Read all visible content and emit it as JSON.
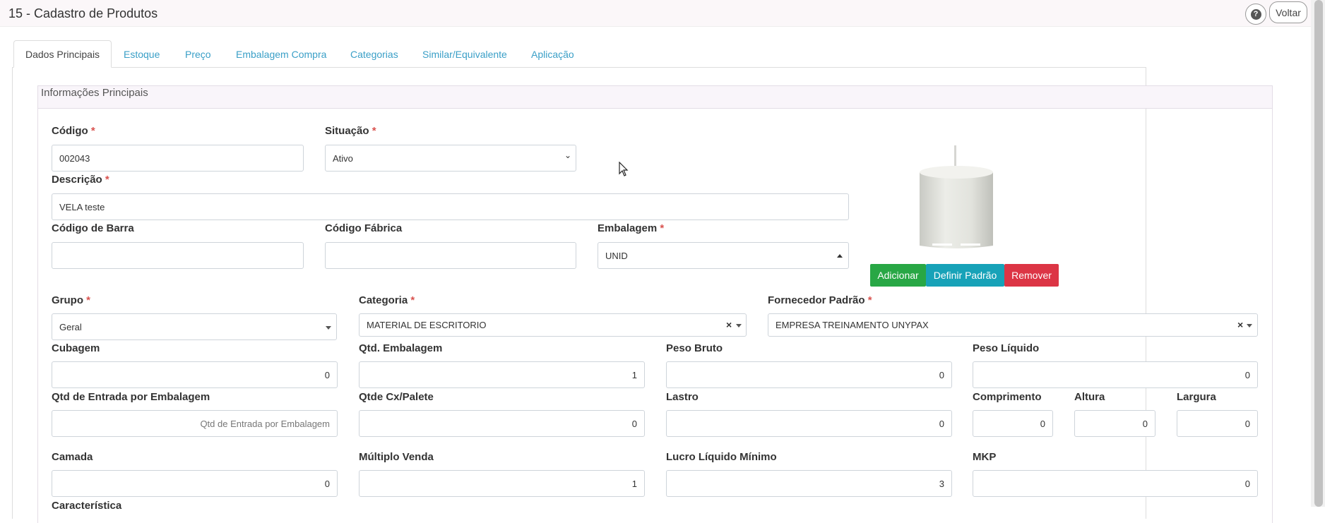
{
  "header": {
    "title": "15 - Cadastro de Produtos",
    "help_icon": "question-circle-icon",
    "help_glyph": "?",
    "back_label": "Voltar"
  },
  "tabs": [
    {
      "label": "Dados Principais",
      "active": true
    },
    {
      "label": "Estoque"
    },
    {
      "label": "Preço"
    },
    {
      "label": "Embalagem Compra"
    },
    {
      "label": "Categorias"
    },
    {
      "label": "Similar/Equivalente"
    },
    {
      "label": "Aplicação"
    }
  ],
  "section": {
    "title": "Informações Principais"
  },
  "required_mark": "*",
  "fields": {
    "codigo": {
      "label": "Código",
      "value": "002043"
    },
    "situacao": {
      "label": "Situação",
      "value": "Ativo"
    },
    "descricao": {
      "label": "Descrição",
      "value": "VELA teste"
    },
    "codigo_barra": {
      "label": "Código de Barra",
      "value": ""
    },
    "codigo_fabrica": {
      "label": "Código Fábrica",
      "value": ""
    },
    "embalagem": {
      "label": "Embalagem",
      "value": "UNID"
    },
    "grupo": {
      "label": "Grupo",
      "value": "Geral"
    },
    "categoria": {
      "label": "Categoria",
      "value": "MATERIAL DE ESCRITORIO"
    },
    "fornecedor": {
      "label": "Fornecedor Padrão",
      "value": "EMPRESA TREINAMENTO UNYPAX"
    },
    "cubagem": {
      "label": "Cubagem",
      "value": "0"
    },
    "qtd_embalagem": {
      "label": "Qtd. Embalagem",
      "value": "1"
    },
    "peso_bruto": {
      "label": "Peso Bruto",
      "value": "0"
    },
    "peso_liquido": {
      "label": "Peso Líquido",
      "value": "0"
    },
    "qtd_entrada": {
      "label": "Qtd de Entrada por Embalagem",
      "placeholder": "Qtd de Entrada por Embalagem"
    },
    "qtde_cx_palete": {
      "label": "Qtde Cx/Palete",
      "value": "0"
    },
    "lastro": {
      "label": "Lastro",
      "value": "0"
    },
    "comprimento": {
      "label": "Comprimento",
      "value": "0"
    },
    "altura": {
      "label": "Altura",
      "value": "0"
    },
    "largura": {
      "label": "Largura",
      "value": "0"
    },
    "camada": {
      "label": "Camada",
      "value": "0"
    },
    "multiplo_venda": {
      "label": "Múltiplo Venda",
      "value": "1"
    },
    "lucro_liquido_minimo": {
      "label": "Lucro Líquido Mínimo",
      "value": "3"
    },
    "mkp": {
      "label": "MKP",
      "value": "0"
    },
    "caracteristica": {
      "label": "Característica"
    }
  },
  "image_actions": {
    "add_label": "Adicionar",
    "add_color": "#28a745",
    "default_label": "Definir Padrão",
    "default_color": "#17a2b8",
    "remove_label": "Remover",
    "remove_color": "#dc3545"
  },
  "glyphs": {
    "clear": "×",
    "chevron": "⌄"
  },
  "scrollbar": {
    "thumb_fraction": 1.0
  }
}
